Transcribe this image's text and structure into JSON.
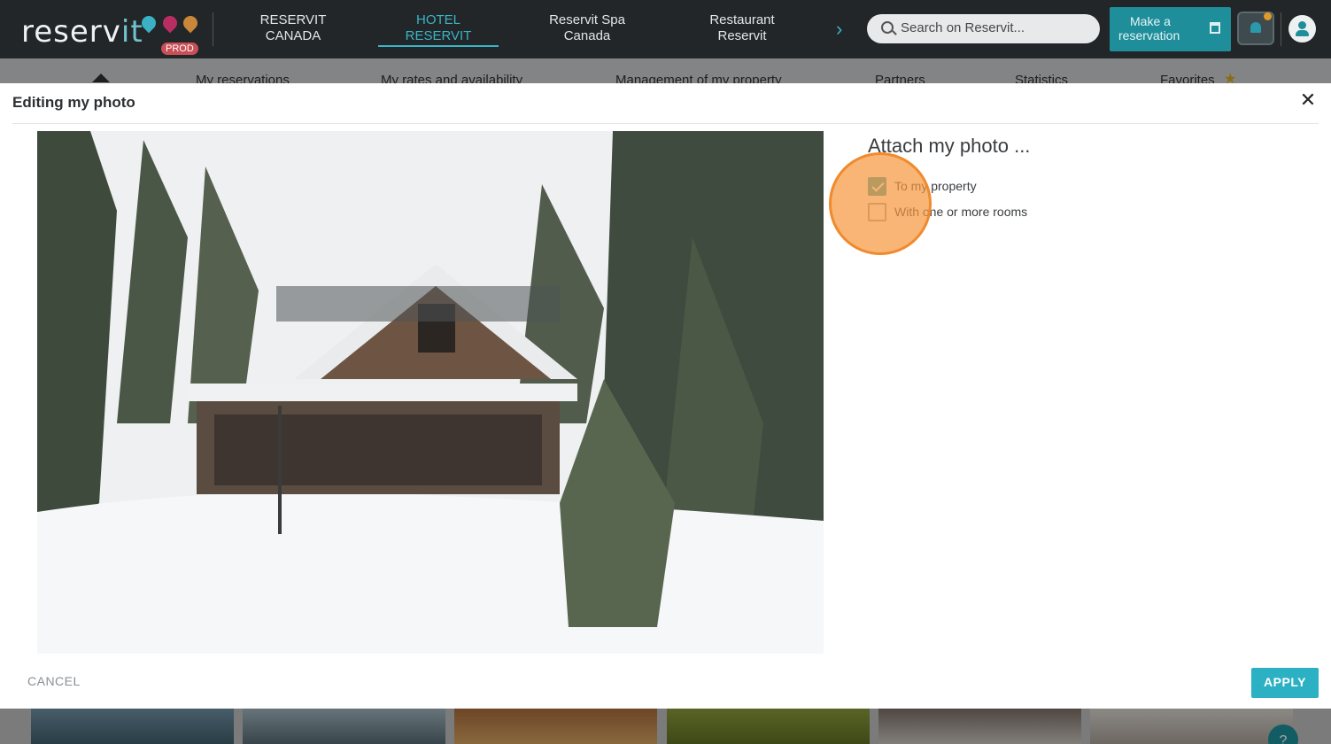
{
  "brand": {
    "logo_main": "reserv",
    "logo_accent": "it",
    "env_badge": "PROD"
  },
  "topnav": {
    "tabs": [
      {
        "label_line1": "RESERVIT",
        "label_line2": "CANADA"
      },
      {
        "label_line1": "HOTEL",
        "label_line2": "RESERVIT"
      },
      {
        "label_line1": "Reservit Spa",
        "label_line2": "Canada"
      },
      {
        "label_line1": "Restaurant",
        "label_line2": "Reservit"
      }
    ],
    "active_tab_index": 1,
    "next_icon": "chevron-right-icon",
    "search_placeholder": "Search on Reservit...",
    "make_reservation_line1": "Make a",
    "make_reservation_line2": "reservation"
  },
  "subnav": {
    "items": [
      "My reservations",
      "My rates and availability",
      "Management of my property",
      "Partners",
      "Statistics",
      "Favorites"
    ]
  },
  "modal": {
    "title": "Editing my photo",
    "close_glyph": "✕",
    "attach_title": "Attach my photo ...",
    "options": [
      {
        "label": "To my property",
        "checked": true
      },
      {
        "label": "With one or more rooms",
        "checked": false
      }
    ],
    "cancel_label": "CANCEL",
    "apply_label": "APPLY"
  },
  "help_glyph": "?",
  "colors": {
    "accent": "#2bb0c4",
    "topbar": "#222629",
    "highlight": "#f08a2c"
  }
}
